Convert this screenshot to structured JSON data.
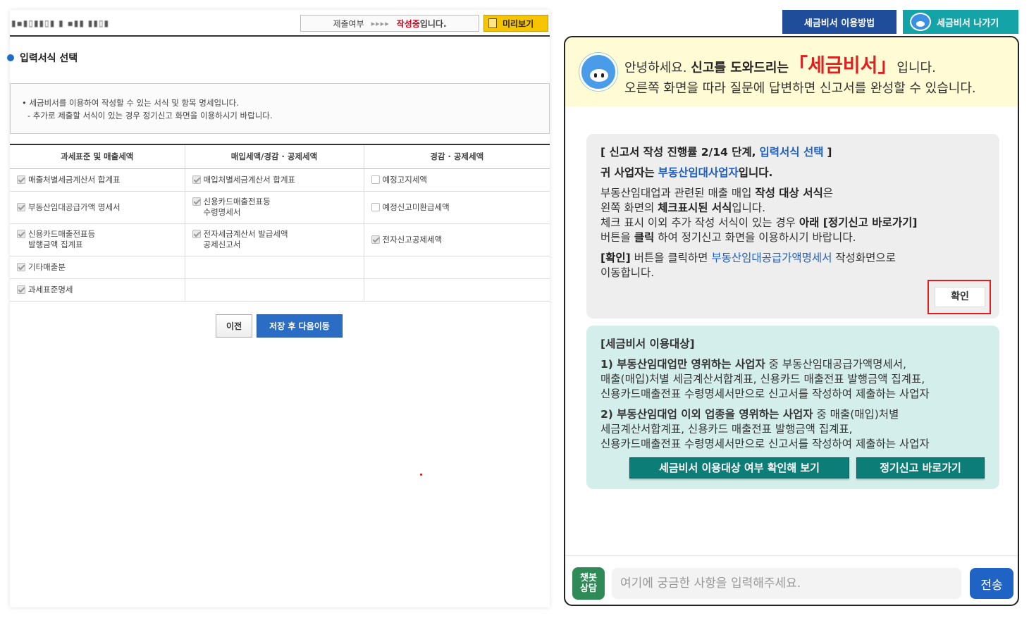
{
  "left": {
    "blurred_title": "▮▪▮▯▮▮▯▮  ▮ ▪▮▮ ▮▮▯▮",
    "status": {
      "label": "제출여부",
      "arrows": "▸▸▸▸",
      "value": "작성중",
      "suffix": "입니다."
    },
    "preview_label": "미리보기",
    "section_title": "입력서식 선택",
    "notice": [
      "• 세금비서를 이용하여 작성할 수 있는 서식 및 항목 명세입니다.",
      "- 추가로 제출할 서식이 있는 경우 정기신고 화면을 이용하시기 바랍니다."
    ],
    "table": {
      "headers": [
        "과세표준 및 매출세액",
        "매입세액/경감 · 공제세액",
        "경감 · 공제세액"
      ],
      "rows": [
        [
          {
            "label": "매출처별세금계산서 합계표",
            "checked": true
          },
          {
            "label": "매입처별세금계산서 합계표",
            "checked": true
          },
          {
            "label": "예정고지세액",
            "checked": false
          }
        ],
        [
          {
            "label": "부동산임대공급가액 명세서",
            "checked": true
          },
          {
            "label": "신용카드매출전표등\n수령명세서",
            "checked": true
          },
          {
            "label": "예정신고미환급세액",
            "checked": false
          }
        ],
        [
          {
            "label": "신용카드매출전표등\n발행금액 집계표",
            "checked": true
          },
          {
            "label": "전자세금계산서 발급세액\n공제신고서",
            "checked": true
          },
          {
            "label": "전자신고공제세액",
            "checked": true
          }
        ],
        [
          {
            "label": "기타매출분",
            "checked": true
          },
          null,
          null
        ],
        [
          {
            "label": "과세표준명세",
            "checked": true
          },
          null,
          null
        ]
      ]
    },
    "prev_label": "이전",
    "next_label": "저장 후 다음이동"
  },
  "tabs": {
    "guide": "세금비서 이용방법",
    "exit": "세금비서 나가기"
  },
  "chat": {
    "greet": {
      "hello": "안녕하세요.",
      "bold": "신고를 도와드리는",
      "brand": "「세금비서」",
      "tail": "입니다.",
      "line2": "오른쪽 화면을 따라 질문에 답변하면 신고서를 완성할 수 있습니다."
    },
    "msg": {
      "progress_a": "[ 신고서 작성 진행률 2/14 단계,",
      "progress_step": "입력서식 선택",
      "progress_b": "]",
      "biz_a": "귀 사업자는",
      "biz_type": "부동산임대사업자",
      "biz_b": "입니다.",
      "p3_a": "부동산임대업과 관련된 매출 매입",
      "p3_b": "작성 대상 서식",
      "p3_c": "은",
      "p3_d": "왼쪽 화면의",
      "p3_e": "체크표시된 서식",
      "p3_f": "입니다.",
      "p3_g": "체크 표시 이외 추가 작성 서식이 있는 경우",
      "p3_h": "아래 [정기신고 바로가기]",
      "p3_i": "버튼을",
      "p3_j": "클릭",
      "p3_k": "하여 정기신고 화면을 이용하시기 바랍니다.",
      "p4_a": "[확인]",
      "p4_b": "버튼을 클릭하면",
      "p4_form": "부동산임대공급가액명세서",
      "p4_c": "작성화면으로",
      "p4_d": "이동합니다.",
      "confirm_label": "확인"
    },
    "target": {
      "title": "[세금비서 이용대상]",
      "item1_bold": "1) 부동산임대업만 영위하는 사업자",
      "item1_rest": "중 부동산임대공급가액명세서,",
      "item1_line2": "매출(매입)처별 세금계산서합계표, 신용카드 매출전표 발행금액 집계표,",
      "item1_line3": "신용카드매출전표 수령명세서만으로 신고서를 작성하여 제출하는 사업자",
      "item2_bold": "2) 부동산임대업 이외 업종을 영위하는 사업자",
      "item2_rest": "중 매출(매입)처별",
      "item2_line2": "세금계산서합계표, 신용카드 매출전표 발행금액 집계표,",
      "item2_line3": "신용카드매출전표 수령명세서만으로 신고서를 작성하여 제출하는 사업자",
      "check_label": "세금비서 이용대상 여부 확인해 보기",
      "regular_label": "정기신고 바로가기"
    },
    "bot_badge": "챗봇\n상담",
    "input_placeholder": "여기에 궁금한 사항을 입력해주세요.",
    "send_label": "전송"
  }
}
